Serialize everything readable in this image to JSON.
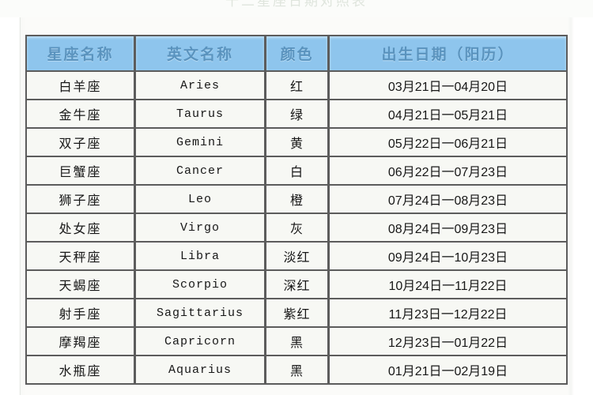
{
  "document": {
    "ghost_title": "十二星座日期对照表",
    "table": {
      "columns": [
        {
          "key": "name",
          "label": "星座名称"
        },
        {
          "key": "en",
          "label": "英文名称"
        },
        {
          "key": "color",
          "label": "颜色"
        },
        {
          "key": "date",
          "label": "出生日期（阳历）"
        }
      ],
      "rows": [
        {
          "name": "白羊座",
          "en": "Aries",
          "color": "红",
          "date": "03月21日一04月20日"
        },
        {
          "name": "金牛座",
          "en": "Taurus",
          "color": "绿",
          "date": "04月21日一05月21日"
        },
        {
          "name": "双子座",
          "en": "Gemini",
          "color": "黄",
          "date": "05月22日一06月21日"
        },
        {
          "name": "巨蟹座",
          "en": "Cancer",
          "color": "白",
          "date": "06月22日一07月23日"
        },
        {
          "name": "狮子座",
          "en": "Leo",
          "color": "橙",
          "date": "07月24日一08月23日"
        },
        {
          "name": "处女座",
          "en": "Virgo",
          "color": "灰",
          "date": "08月24日一09月23日"
        },
        {
          "name": "天秤座",
          "en": "Libra",
          "color": "淡红",
          "date": "09月24日一10月23日"
        },
        {
          "name": "天蝎座",
          "en": "Scorpio",
          "color": "深红",
          "date": "10月24日一11月22日"
        },
        {
          "name": "射手座",
          "en": "Sagittarius",
          "color": "紫红",
          "date": "11月23日一12月22日"
        },
        {
          "name": "摩羯座",
          "en": "Capricorn",
          "color": "黑",
          "date": "12月23日一01月22日"
        },
        {
          "name": "水瓶座",
          "en": "Aquarius",
          "color": "黑",
          "date": "01月21日一02月19日"
        }
      ]
    }
  },
  "colors": {
    "header_background": "#8cc3ea",
    "header_text": "#5a93bd",
    "row_background": "#f2f3ef",
    "border": "#5d5d5d",
    "page_background": "#fbfbf9"
  }
}
